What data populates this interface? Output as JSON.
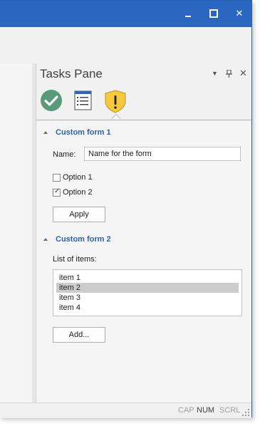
{
  "pane": {
    "title": "Tasks Pane",
    "controls": {
      "dropdown": "▼",
      "pin": "⊥",
      "close": "✕"
    },
    "tabs": [
      {
        "icon": "check-circle-icon",
        "color": "#5a9a7c"
      },
      {
        "icon": "list-icon"
      },
      {
        "icon": "warning-shield-icon",
        "color": "#f6c93b",
        "selected": true
      }
    ]
  },
  "form1": {
    "title": "Custom form 1",
    "name_label": "Name:",
    "name_value": "Name for the form",
    "option1_label": "Option 1",
    "option1_checked": false,
    "option2_label": "Option 2",
    "option2_checked": true,
    "apply_label": "Apply"
  },
  "form2": {
    "title": "Custom form 2",
    "list_label": "List of items:",
    "items": [
      "item 1",
      "item 2",
      "item 3",
      "item 4"
    ],
    "selected_index": 1,
    "add_label": "Add..."
  },
  "status": {
    "cap": "CAP",
    "num": "NUM",
    "scrl": "SCRL"
  },
  "colors": {
    "titlebar": "#2b66c0",
    "accent": "#2a62b8",
    "selected_item": "#cccccc"
  }
}
